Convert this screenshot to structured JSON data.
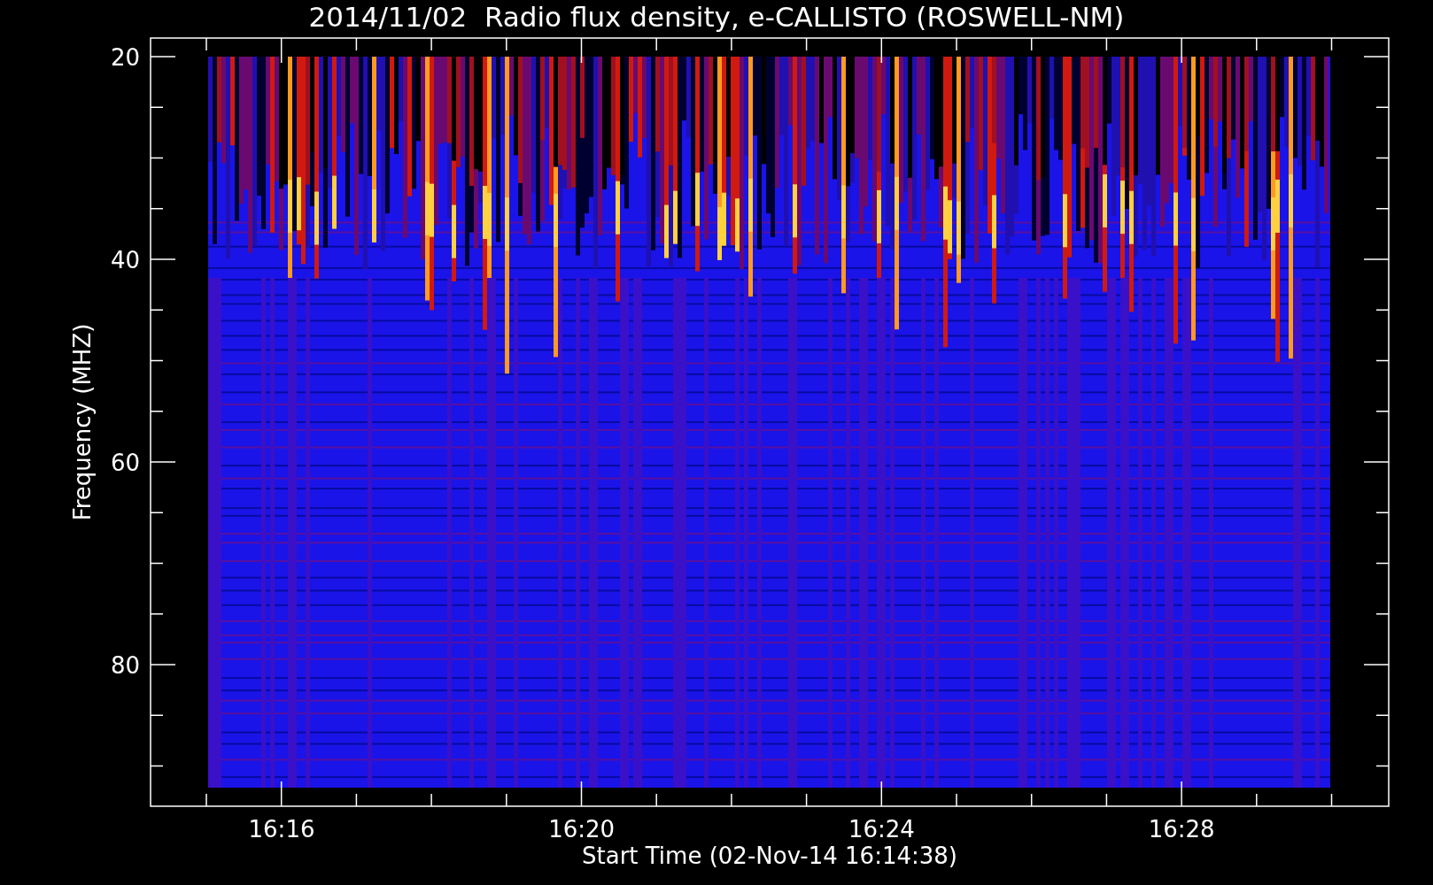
{
  "title": "2014/11/02  Radio flux density, e-CALLISTO (ROSWELL-NM)",
  "y_axis": {
    "label": "Frequency (MHZ)",
    "ticks": [
      "20",
      "40",
      "60",
      "80"
    ]
  },
  "x_axis": {
    "label": "Start Time (02-Nov-14 16:14:38)",
    "ticks": [
      "16:16",
      "16:20",
      "16:24",
      "16:28"
    ]
  }
}
